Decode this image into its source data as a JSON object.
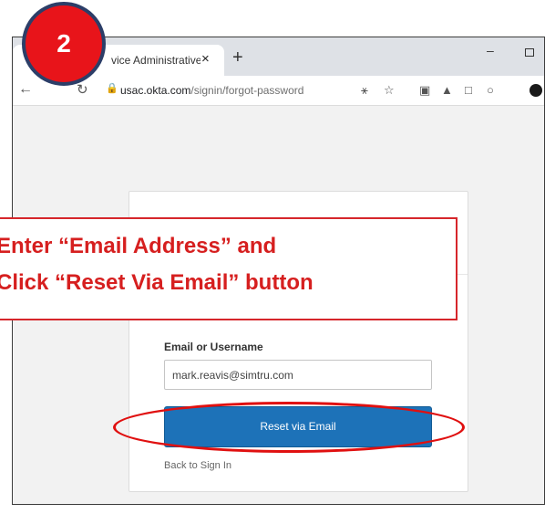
{
  "step": {
    "number": "2"
  },
  "browser": {
    "tab_title": "vice Administrative",
    "tab_close": "×",
    "new_tab": "+",
    "minimize": "–",
    "url_host": "usac.okta.com",
    "url_path": "/signin/forgot-password"
  },
  "form": {
    "field_label": "Email or Username",
    "email_value": "mark.reavis@simtru.com",
    "reset_button_label": "Reset via Email",
    "back_link": "Back to Sign In"
  },
  "annotation": {
    "line1": "Enter “Email Address” and",
    "line2": "Click “Reset Via Email” button",
    "accent_color": "#d61f1f"
  },
  "colors": {
    "button": "#1d72b8",
    "badge": "#e8141a",
    "badge_border": "#2c3e68"
  }
}
